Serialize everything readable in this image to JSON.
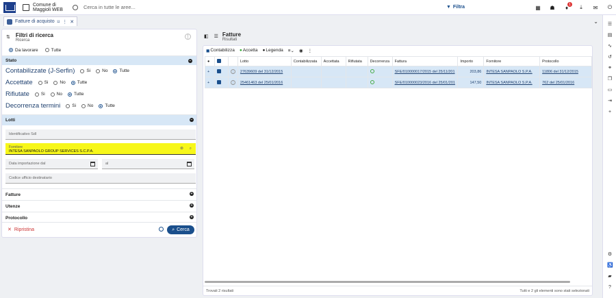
{
  "header": {
    "org_line1": "Comune di",
    "org_line2": "Maggioli WEB",
    "search_placeholder": "Cerca in tutte le aree...",
    "filter_label": "Filtra",
    "notif_count": "1"
  },
  "tab": {
    "label": "Fatture di acquisto"
  },
  "filters": {
    "title": "Filtri di ricerca",
    "subtitle": "Ricerca",
    "top_radio": [
      "Da lavorare",
      "Tutte"
    ],
    "stato_label": "Stato",
    "rows": [
      {
        "label": "Contabilizzate (J-Serfin)",
        "opts": [
          "Si",
          "No",
          "Tutte"
        ]
      },
      {
        "label": "Accettate",
        "opts": [
          "Si",
          "No",
          "Tutte"
        ]
      },
      {
        "label": "Rifiutate",
        "opts": [
          "Si",
          "No",
          "Tutte"
        ]
      },
      {
        "label": "Decorrenza termini",
        "opts": [
          "Si",
          "No",
          "Tutte"
        ]
      }
    ],
    "lotti_label": "Lotti",
    "id_sdi": "Identificativo SdI",
    "fornitore_label": "Fornitore",
    "fornitore_value": "INTESA SANPAOLO GROUP SERVICES S.C.P.A.",
    "data_dal": "Data importazione dal",
    "data_al": "al",
    "codice": "Codice ufficio destinatario",
    "fatture": "Fatture",
    "utenze": "Utenze",
    "protocollo": "Protocollo",
    "ripristina": "Ripristina",
    "cerca": "Cerca"
  },
  "results": {
    "title": "Fatture",
    "subtitle": "Risultati",
    "toolbar": [
      "Contabilizza",
      "Accetta",
      "Legenda"
    ],
    "columns": [
      "Lotto",
      "Contabilizzata",
      "Accettata",
      "Rifiutata",
      "Decorrenza",
      "Fattura",
      "Importo",
      "Fornitore",
      "Protocollo"
    ],
    "rows": [
      {
        "lotto": "27639609 del 31/12/2015",
        "fattura": "SFE/010000017/2015 del 25/11/201",
        "importo": "203,86",
        "fornitore": "INTESA SANPAOLO S.P.A.",
        "protocollo": "11806 del 31/12/2015"
      },
      {
        "lotto": "25461463 del 25/01/2016",
        "fattura": "SFE/010000023/2016 del 25/01/201",
        "importo": "147,50",
        "fornitore": "INTESA SANPAOLO S.P.A.",
        "protocollo": "762 del 25/01/2016"
      }
    ],
    "footer_left": "Trovati 2 risultati",
    "footer_right": "Tutti e 2 gli elementi sono stati selezionati"
  }
}
